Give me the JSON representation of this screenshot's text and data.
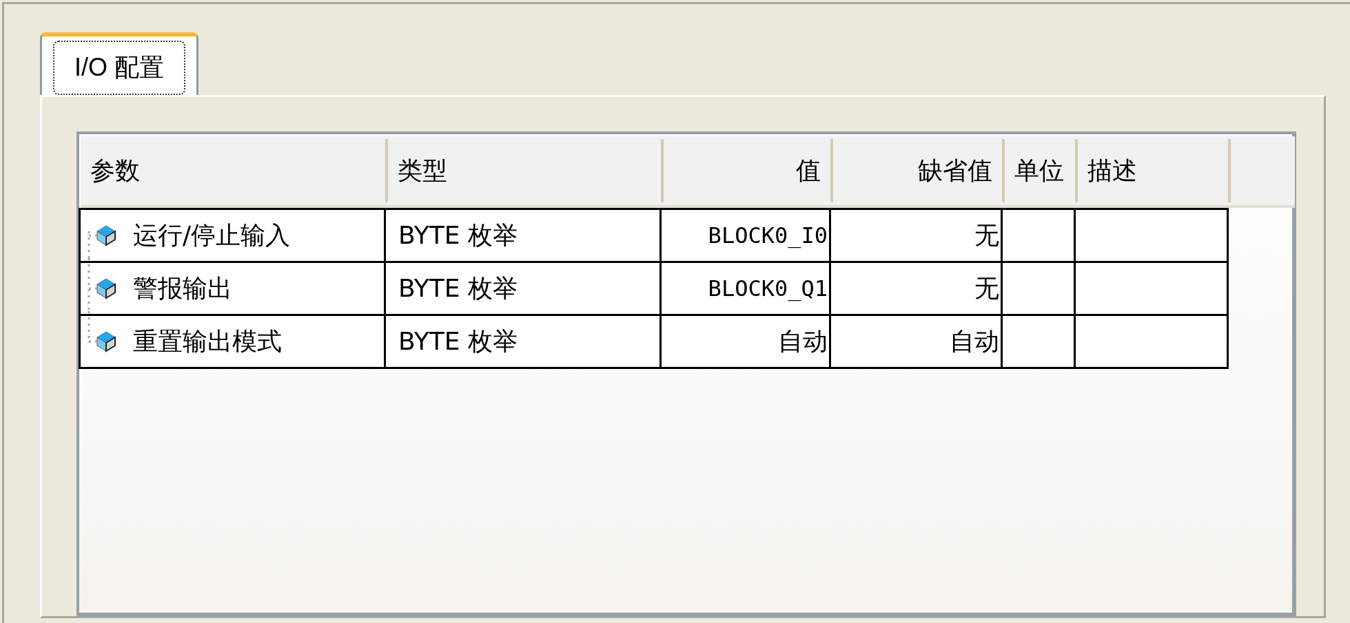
{
  "tabs": [
    {
      "label": "I/O 配置",
      "selected": true
    }
  ],
  "table": {
    "columns": [
      "参数",
      "类型",
      "值",
      "缺省值",
      "单位",
      "描述"
    ],
    "rows": [
      {
        "cells": [
          "运行/停止输入",
          "BYTE 枚举",
          "BLOCK0_I0",
          "无",
          "",
          ""
        ]
      },
      {
        "cells": [
          "警报输出",
          "BYTE 枚举",
          "BLOCK0_Q1",
          "无",
          "",
          ""
        ]
      },
      {
        "cells": [
          "重置输出模式",
          "BYTE 枚举",
          "自动",
          "自动",
          "",
          ""
        ]
      }
    ]
  }
}
